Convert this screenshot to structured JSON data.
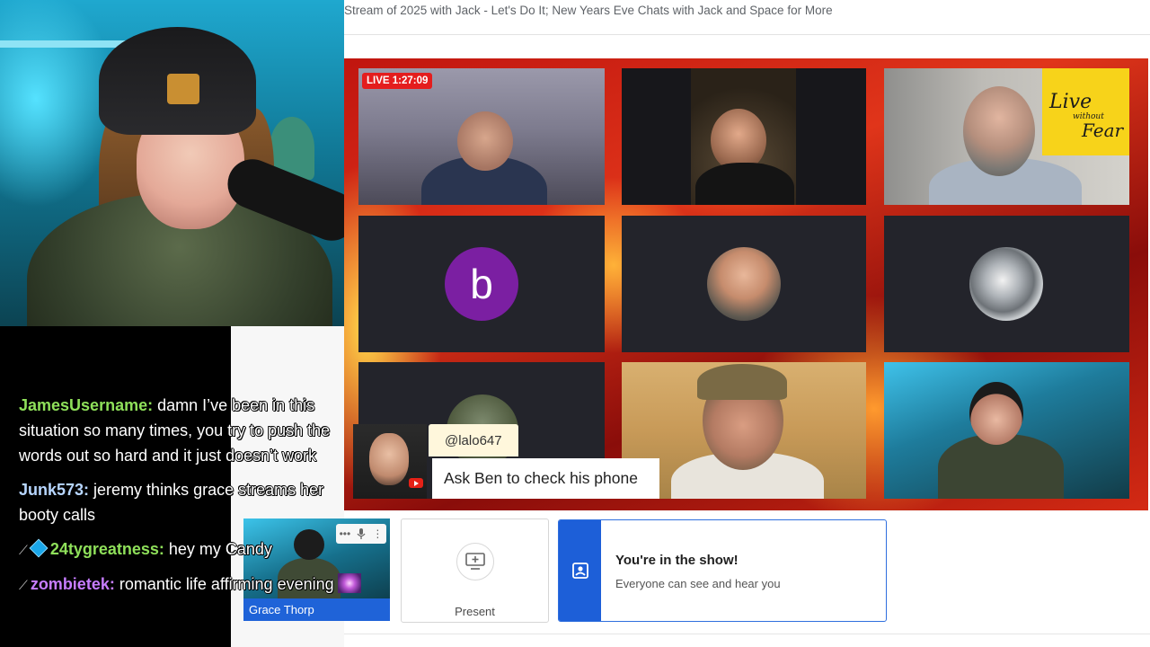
{
  "stream": {
    "title": "Stream of 2025 with Jack - Let's Do It; New Years Eve Chats with Jack and Space for More"
  },
  "stage": {
    "live_badge": "LIVE 1:27:09",
    "logo_line1": "Live",
    "logo_line2": "without",
    "logo_line3": "Fear",
    "avatar_letter": "b"
  },
  "comment_overlay": {
    "username": "@lalo647",
    "text": "Ask Ben to check his phone"
  },
  "chat": {
    "messages": [
      {
        "user": "JamesUsername:",
        "user_color": "#8fe05a",
        "text": " damn I’ve been in this situation so many times, you try to push the words out so hard and it just doesn’t work"
      },
      {
        "user": "Junk573:",
        "user_color": "#b7d6ff",
        "text": " jeremy thinks grace streams her booty calls"
      },
      {
        "user": "24tygreatness:",
        "user_color": "#8fe05a",
        "text": " hey my Candy"
      },
      {
        "user": "zombietek:",
        "user_color": "#c77dff",
        "text": " romantic life affirming evening"
      }
    ]
  },
  "self_preview": {
    "name": "Grace Thorp"
  },
  "controls": {
    "present_label": "Present",
    "show_title": "You're in the show!",
    "show_subtitle": "Everyone can see and hear you"
  },
  "icons": {
    "present": "present-screen-icon",
    "badge": "person-badge-icon",
    "mic": "microphone-icon",
    "more": "more-vert-icon"
  }
}
